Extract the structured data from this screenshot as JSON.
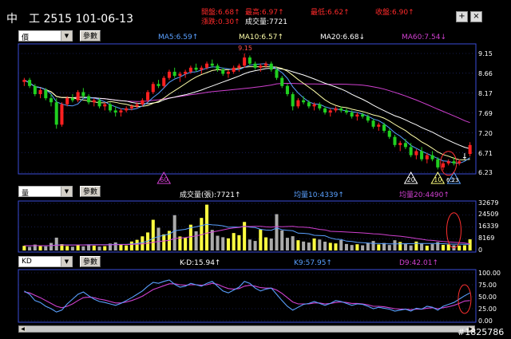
{
  "header": {
    "title": "中　工 2515 101-06-13",
    "stats": [
      {
        "text": "開盤:6.68↑",
        "color": "red"
      },
      {
        "text": "最高:6.97↑",
        "color": "red"
      },
      {
        "text": "最低:6.62↑",
        "color": "red"
      },
      {
        "text": "收盤:6.90↑",
        "color": "red"
      },
      {
        "text": "漲跌:0.30↑",
        "color": "red"
      },
      {
        "text": "成交量:7721",
        "color": "white"
      }
    ],
    "plus": "+",
    "close": "×"
  },
  "price_panel": {
    "select": "價",
    "param": "參數",
    "ma": [
      {
        "text": "MA5:6.59↑",
        "color": "#5aa0ff"
      },
      {
        "text": "MA10:6.57↑",
        "color": "#ffffaa"
      },
      {
        "text": "MA20:6.68↓",
        "color": "#ffffff"
      },
      {
        "text": "MA60:7.54↓",
        "color": "#d040d0"
      }
    ],
    "ticks": [
      "9.15",
      "8.66",
      "8.17",
      "7.69",
      "7.20",
      "6.71",
      "6.23"
    ],
    "high_label": "9.15",
    "low_label": "6.23",
    "markers": [
      "60",
      "20",
      "10",
      "5"
    ]
  },
  "volume_panel": {
    "select": "量",
    "param": "參數",
    "labels": [
      {
        "text": "成交量(張):7721↑",
        "color": "#ffffff"
      },
      {
        "text": "均量10:4339↑",
        "color": "#5aa0ff"
      },
      {
        "text": "均量20:4490↑",
        "color": "#d040d0"
      }
    ],
    "ticks": [
      "32679",
      "24509",
      "16339",
      "8169",
      "0"
    ]
  },
  "kd_panel": {
    "select": "KD",
    "param": "參數",
    "labels": [
      {
        "text": "K-D:15.94↑",
        "color": "#ffffff"
      },
      {
        "text": "K9:57.95↑",
        "color": "#5aa0ff"
      },
      {
        "text": "D9:42.01↑",
        "color": "#d040d0"
      }
    ],
    "ticks": [
      "100.00",
      "75.00",
      "50.00",
      "25.00",
      "0.00"
    ]
  },
  "watermark": "#1825786",
  "colors": {
    "up": "#ff2020",
    "down": "#20d020",
    "flat": "#ffffff",
    "grid": "#3a4bd8",
    "ma5": "#5aa0ff",
    "ma10": "#ffffaa",
    "ma20": "#ffffff",
    "ma60": "#d040d0",
    "vol_up": "#ffff40",
    "vol_down": "#aaaaaa"
  },
  "chart_data": [
    {
      "type": "candlestick",
      "title": "中　工 2515 101-06-13",
      "ylim": [
        6.23,
        9.15
      ],
      "candles": [
        [
          8.45,
          8.55,
          8.35,
          8.5
        ],
        [
          8.5,
          8.55,
          8.3,
          8.35
        ],
        [
          8.35,
          8.4,
          8.1,
          8.15
        ],
        [
          8.15,
          8.3,
          8.05,
          8.25
        ],
        [
          8.25,
          8.3,
          8.0,
          8.05
        ],
        [
          8.05,
          8.15,
          7.85,
          7.95
        ],
        [
          7.95,
          8.05,
          7.3,
          7.4
        ],
        [
          7.4,
          7.95,
          7.35,
          7.9
        ],
        [
          7.9,
          8.1,
          7.85,
          8.05
        ],
        [
          8.05,
          8.15,
          7.95,
          8.0
        ],
        [
          8.0,
          8.25,
          7.95,
          8.2
        ],
        [
          8.2,
          8.3,
          8.05,
          8.1
        ],
        [
          8.1,
          8.15,
          7.9,
          7.95
        ],
        [
          7.95,
          8.05,
          7.85,
          8.0
        ],
        [
          8.0,
          8.05,
          7.8,
          7.85
        ],
        [
          7.85,
          7.95,
          7.75,
          7.9
        ],
        [
          7.9,
          7.95,
          7.7,
          7.75
        ],
        [
          7.75,
          7.85,
          7.6,
          7.7
        ],
        [
          7.7,
          7.8,
          7.6,
          7.75
        ],
        [
          7.75,
          7.85,
          7.7,
          7.8
        ],
        [
          7.8,
          7.9,
          7.75,
          7.85
        ],
        [
          7.85,
          7.95,
          7.8,
          7.9
        ],
        [
          7.9,
          8.05,
          7.85,
          8.0
        ],
        [
          8.0,
          8.25,
          7.95,
          8.2
        ],
        [
          8.2,
          8.45,
          8.15,
          8.4
        ],
        [
          8.4,
          8.5,
          8.3,
          8.35
        ],
        [
          8.35,
          8.6,
          8.3,
          8.55
        ],
        [
          8.55,
          8.75,
          8.5,
          8.7
        ],
        [
          8.7,
          8.8,
          8.55,
          8.6
        ],
        [
          8.6,
          8.7,
          8.45,
          8.65
        ],
        [
          8.65,
          8.75,
          8.55,
          8.7
        ],
        [
          8.7,
          8.85,
          8.65,
          8.8
        ],
        [
          8.8,
          8.9,
          8.7,
          8.75
        ],
        [
          8.75,
          8.85,
          8.65,
          8.8
        ],
        [
          8.8,
          8.95,
          8.75,
          8.9
        ],
        [
          8.9,
          9.0,
          8.8,
          8.85
        ],
        [
          8.85,
          8.9,
          8.7,
          8.75
        ],
        [
          8.75,
          8.8,
          8.6,
          8.65
        ],
        [
          8.65,
          8.75,
          8.55,
          8.7
        ],
        [
          8.7,
          8.85,
          8.65,
          8.8
        ],
        [
          8.8,
          8.9,
          8.7,
          8.85
        ],
        [
          8.85,
          9.15,
          8.8,
          9.05
        ],
        [
          9.05,
          9.1,
          8.85,
          8.9
        ],
        [
          8.9,
          8.95,
          8.75,
          8.8
        ],
        [
          8.8,
          8.9,
          8.7,
          8.85
        ],
        [
          8.85,
          8.95,
          8.8,
          8.9
        ],
        [
          8.9,
          8.95,
          8.7,
          8.75
        ],
        [
          8.75,
          8.8,
          8.5,
          8.55
        ],
        [
          8.55,
          8.6,
          8.3,
          8.35
        ],
        [
          8.35,
          8.4,
          8.1,
          8.15
        ],
        [
          8.15,
          8.2,
          7.75,
          7.85
        ],
        [
          7.85,
          8.05,
          7.8,
          8.0
        ],
        [
          8.0,
          8.1,
          7.9,
          7.95
        ],
        [
          7.95,
          8.0,
          7.8,
          7.85
        ],
        [
          7.85,
          7.95,
          7.75,
          7.9
        ],
        [
          7.9,
          7.95,
          7.75,
          7.8
        ],
        [
          7.8,
          7.85,
          7.65,
          7.7
        ],
        [
          7.7,
          7.8,
          7.6,
          7.75
        ],
        [
          7.75,
          7.85,
          7.7,
          7.8
        ],
        [
          7.8,
          7.85,
          7.7,
          7.75
        ],
        [
          7.75,
          7.8,
          7.65,
          7.7
        ],
        [
          7.7,
          7.75,
          7.55,
          7.6
        ],
        [
          7.6,
          7.7,
          7.5,
          7.65
        ],
        [
          7.65,
          7.7,
          7.55,
          7.6
        ],
        [
          7.6,
          7.65,
          7.45,
          7.5
        ],
        [
          7.5,
          7.55,
          7.3,
          7.35
        ],
        [
          7.35,
          7.45,
          7.25,
          7.4
        ],
        [
          7.4,
          7.45,
          7.2,
          7.25
        ],
        [
          7.25,
          7.3,
          7.05,
          7.1
        ],
        [
          7.1,
          7.15,
          6.85,
          6.9
        ],
        [
          6.9,
          7.0,
          6.75,
          6.95
        ],
        [
          6.95,
          7.05,
          6.8,
          6.85
        ],
        [
          6.85,
          6.95,
          6.6,
          6.65
        ],
        [
          6.65,
          6.8,
          6.55,
          6.75
        ],
        [
          6.75,
          6.85,
          6.5,
          6.55
        ],
        [
          6.55,
          6.7,
          6.45,
          6.65
        ],
        [
          6.65,
          6.75,
          6.5,
          6.55
        ],
        [
          6.55,
          6.6,
          6.3,
          6.35
        ],
        [
          6.35,
          6.5,
          6.28,
          6.45
        ],
        [
          6.45,
          6.55,
          6.4,
          6.5
        ],
        [
          6.5,
          6.6,
          6.4,
          6.45
        ],
        [
          6.45,
          6.55,
          6.4,
          6.5
        ],
        [
          6.6,
          6.7,
          6.55,
          6.6
        ],
        [
          6.68,
          6.97,
          6.62,
          6.9
        ]
      ]
    },
    {
      "type": "bar",
      "title": "成交量(張)",
      "ylim": [
        0,
        32679
      ],
      "values": [
        3200,
        2500,
        4100,
        3000,
        2800,
        5200,
        8900,
        4400,
        3100,
        2600,
        3600,
        2900,
        4200,
        3300,
        2700,
        3000,
        4800,
        5600,
        4100,
        3500,
        6200,
        7400,
        9800,
        12500,
        21300,
        15800,
        11200,
        13600,
        24500,
        9700,
        8800,
        17900,
        13300,
        22600,
        31800,
        14300,
        10200,
        9200,
        8400,
        12100,
        10600,
        19800,
        7600,
        6600,
        14600,
        9100,
        8300,
        25200,
        13900,
        8800,
        9900,
        7100,
        6200,
        5500,
        8300,
        7600,
        6100,
        5300,
        4900,
        7200,
        4500,
        3800,
        4300,
        3600,
        5100,
        6600,
        4200,
        5200,
        3800,
        7100,
        5900,
        4400,
        3500,
        6200,
        4800,
        3300,
        4400,
        5800,
        3900,
        4100,
        3600,
        3400,
        3600,
        7721
      ],
      "series": [
        {
          "name": "均量10",
          "values": [
            3300,
            3200,
            3300,
            3300,
            3200,
            3400,
            3800,
            3900,
            3900,
            3800,
            3900,
            3900,
            4000,
            4000,
            4000,
            4000,
            4100,
            4200,
            4200,
            4200,
            4500,
            4900,
            5500,
            6500,
            8500,
            9700,
            10500,
            11400,
            13600,
            14200,
            14700,
            15800,
            16400,
            17200,
            18200,
            17800,
            17600,
            17100,
            16100,
            16300,
            16200,
            16800,
            16200,
            15900,
            14700,
            14200,
            14000,
            15600,
            14400,
            14000,
            13700,
            12000,
            11900,
            11600,
            10500,
            10400,
            10200,
            8700,
            7800,
            7600,
            6500,
            6200,
            5600,
            5400,
            5200,
            4900,
            4800,
            4700,
            4600,
            4600,
            4600,
            4700,
            4700,
            4900,
            4900,
            4800,
            4800,
            4800,
            4700,
            4500,
            4400,
            4400,
            4300,
            4339
          ]
        },
        {
          "name": "均量20",
          "values": [
            3300,
            3300,
            3300,
            3300,
            3300,
            3400,
            3600,
            3700,
            3700,
            3700,
            3800,
            3800,
            3800,
            3800,
            3900,
            3900,
            3900,
            4000,
            4100,
            4100,
            4200,
            4400,
            4600,
            5000,
            5700,
            6200,
            6600,
            7100,
            8300,
            8600,
            8900,
            9600,
            10100,
            10900,
            12100,
            12800,
            13500,
            14300,
            15100,
            15700,
            16000,
            16800,
            16600,
            16700,
            16700,
            16400,
            16200,
            16600,
            16500,
            16600,
            16800,
            16300,
            16200,
            15900,
            15300,
            14600,
            14300,
            13300,
            13100,
            13000,
            12800,
            12600,
            12400,
            12200,
            11900,
            11600,
            11400,
            11000,
            10500,
            10200,
            9900,
            9400,
            8900,
            8300,
            7800,
            7200,
            7000,
            6600,
            6200,
            6000,
            5700,
            5500,
            5200,
            4490
          ]
        }
      ]
    },
    {
      "type": "line",
      "title": "KD",
      "ylim": [
        0,
        100
      ],
      "series": [
        {
          "name": "K9",
          "values": [
            62,
            55,
            42,
            38,
            30,
            25,
            18,
            22,
            35,
            45,
            55,
            60,
            52,
            45,
            40,
            38,
            35,
            32,
            36,
            42,
            48,
            55,
            62,
            72,
            80,
            78,
            82,
            85,
            76,
            70,
            72,
            78,
            75,
            72,
            78,
            82,
            72,
            62,
            58,
            64,
            70,
            82,
            78,
            68,
            62,
            66,
            68,
            55,
            42,
            30,
            22,
            28,
            34,
            36,
            40,
            36,
            32,
            36,
            42,
            40,
            36,
            32,
            35,
            34,
            30,
            25,
            28,
            26,
            24,
            20,
            22,
            24,
            20,
            26,
            24,
            30,
            28,
            22,
            30,
            34,
            38,
            45,
            52,
            57.95
          ]
        },
        {
          "name": "D9",
          "values": [
            60,
            58,
            53,
            48,
            42,
            36,
            30,
            27,
            30,
            35,
            42,
            48,
            49,
            48,
            45,
            43,
            40,
            37,
            37,
            39,
            42,
            46,
            51,
            58,
            65,
            69,
            73,
            77,
            77,
            75,
            74,
            75,
            75,
            74,
            75,
            78,
            76,
            71,
            67,
            66,
            67,
            72,
            74,
            72,
            69,
            68,
            68,
            64,
            57,
            48,
            39,
            35,
            35,
            35,
            37,
            37,
            35,
            36,
            38,
            39,
            38,
            36,
            36,
            35,
            33,
            30,
            30,
            29,
            27,
            25,
            24,
            24,
            23,
            24,
            24,
            26,
            27,
            25,
            27,
            29,
            32,
            36,
            41,
            42.01
          ]
        }
      ]
    }
  ]
}
